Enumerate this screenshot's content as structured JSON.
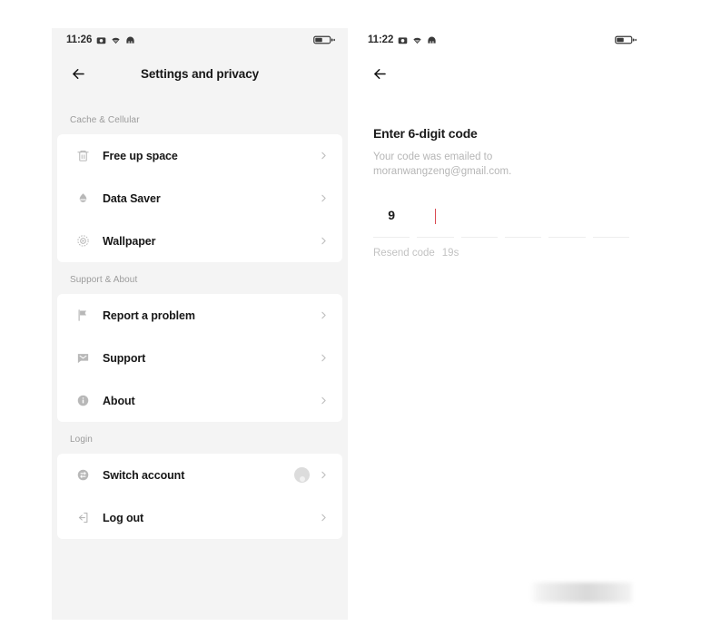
{
  "left_screen": {
    "status_bar": {
      "time": "11:26",
      "icons": [
        "camera-icon",
        "wifi-icon",
        "signal-icon"
      ],
      "battery": "battery-charging-icon"
    },
    "nav": {
      "back_icon": "back-arrow-icon",
      "title": "Settings and privacy"
    },
    "sections": [
      {
        "header": "Cache & Cellular",
        "items": [
          {
            "icon": "trash-icon",
            "label": "Free up space",
            "chevron": "chevron-right-icon"
          },
          {
            "icon": "droplet-icon",
            "label": "Data Saver",
            "chevron": "chevron-right-icon"
          },
          {
            "icon": "wallpaper-icon",
            "label": "Wallpaper",
            "chevron": "chevron-right-icon"
          }
        ]
      },
      {
        "header": "Support & About",
        "items": [
          {
            "icon": "flag-icon",
            "label": "Report a problem",
            "chevron": "chevron-right-icon"
          },
          {
            "icon": "chat-bubble-icon",
            "label": "Support",
            "chevron": "chevron-right-icon"
          },
          {
            "icon": "info-icon",
            "label": "About",
            "chevron": "chevron-right-icon"
          }
        ]
      },
      {
        "header": "Login",
        "items": [
          {
            "icon": "switch-account-icon",
            "label": "Switch account",
            "avatar": "user-avatar",
            "chevron": "chevron-right-icon"
          },
          {
            "icon": "logout-icon",
            "label": "Log out",
            "chevron": "chevron-right-icon"
          }
        ]
      }
    ]
  },
  "right_screen": {
    "status_bar": {
      "time": "11:22",
      "icons": [
        "camera-icon",
        "wifi-icon",
        "signal-icon"
      ],
      "battery": "battery-charging-icon"
    },
    "nav": {
      "back_icon": "back-arrow-icon"
    },
    "title": "Enter 6-digit code",
    "subtitle": "Your code was emailed to moranwangzeng@gmail.com.",
    "code_cells": [
      "9",
      "",
      "",
      "",
      "",
      ""
    ],
    "caret_index": 1,
    "caret_color": "#d94a52",
    "resend_label": "Resend code",
    "resend_timer": "19s"
  }
}
